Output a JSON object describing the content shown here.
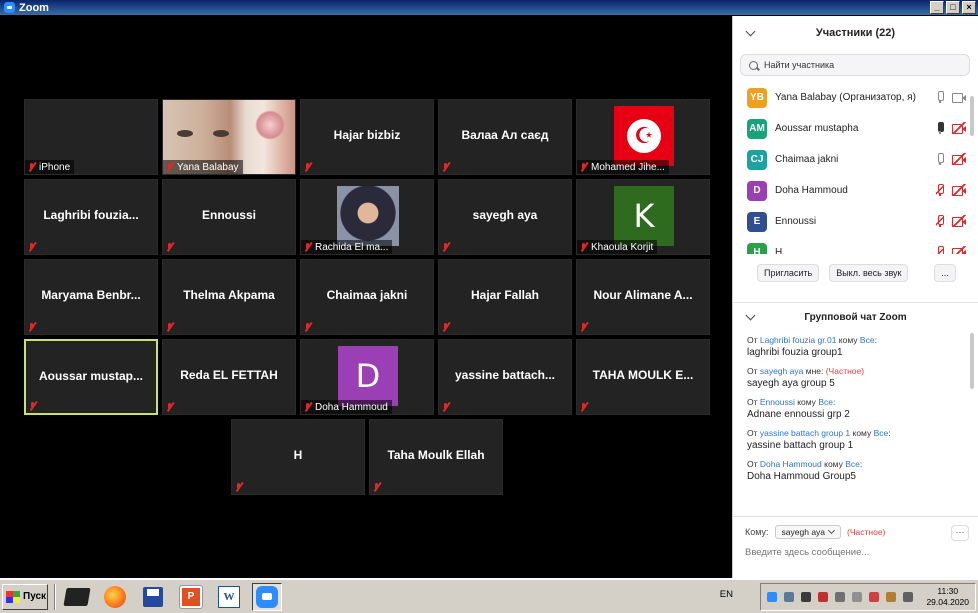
{
  "window": {
    "title": "Zoom"
  },
  "tiles": [
    {
      "name": "iPhone",
      "display": "label"
    },
    {
      "name": "Yana Balabay",
      "display": "photo-face"
    },
    {
      "name": "Hajar bizbiz",
      "display": "center"
    },
    {
      "name": "Валаа Ал саєд",
      "display": "center"
    },
    {
      "name": "Mohamed Jihe...",
      "display": "flag"
    },
    {
      "name": "Laghribi  fouzia...",
      "display": "center"
    },
    {
      "name": "Ennoussi",
      "display": "center"
    },
    {
      "name": "Rachida El ma...",
      "display": "photo-hijab"
    },
    {
      "name": "sayegh aya",
      "display": "center"
    },
    {
      "name": "Khaoula Korjit",
      "display": "avatar",
      "letter": "K",
      "color": "#2e6b1f"
    },
    {
      "name": "Maryama  Benbr...",
      "display": "center"
    },
    {
      "name": "Thelma Akpama",
      "display": "center"
    },
    {
      "name": "Chaimaa jakni",
      "display": "center"
    },
    {
      "name": "Hajar Fallah",
      "display": "center"
    },
    {
      "name": "Nour Alimane A...",
      "display": "center"
    },
    {
      "name": "Aoussar mustap...",
      "display": "center",
      "active": true
    },
    {
      "name": "Reda EL FETTAH",
      "display": "center"
    },
    {
      "name": "Doha Hammoud",
      "display": "avatar",
      "letter": "D",
      "color": "#9b3fb5"
    },
    {
      "name": "yassine  battach...",
      "display": "center"
    },
    {
      "name": "TAHA MOULK E...",
      "display": "center"
    },
    {
      "name": "H",
      "display": "center"
    },
    {
      "name": "Taha Moulk Ellah",
      "display": "center"
    }
  ],
  "participants_panel": {
    "title": "Участники (22)",
    "search_placeholder": "Найти участника",
    "list": [
      {
        "initials": "YB",
        "name": "Yana Balabay (Организатор, я)",
        "color": "#f0a020",
        "mic": "on",
        "cam": "on"
      },
      {
        "initials": "AM",
        "name": "Aoussar mustapha",
        "color": "#1aa37a",
        "mic": "dark",
        "cam": "off"
      },
      {
        "initials": "CJ",
        "name": "Chaimaa jakni",
        "color": "#1aa3a0",
        "mic": "on",
        "cam": "off"
      },
      {
        "initials": "D",
        "name": "Doha Hammoud",
        "color": "#9b3fb5",
        "mic": "off",
        "cam": "off"
      },
      {
        "initials": "E",
        "name": "Ennoussi",
        "color": "#2f4f8f",
        "mic": "off",
        "cam": "off"
      },
      {
        "initials": "H",
        "name": "H",
        "color": "#2aa04a",
        "mic": "off",
        "cam": "off"
      }
    ],
    "invite_label": "Пригласить",
    "mute_all_label": "Выкл. весь звук",
    "more_label": "..."
  },
  "chat": {
    "title": "Групповой чат Zoom",
    "messages": [
      {
        "prefix": "От ",
        "from": "Laghribi fouzia gr.01",
        "mid": " кому ",
        "to": "Все",
        "suffix": ":",
        "private": "",
        "text": "laghribi fouzia group1"
      },
      {
        "prefix": "От ",
        "from": "sayegh aya",
        "mid": " мне: ",
        "to": "",
        "suffix": "",
        "private": "(Частное)",
        "text": "sayegh aya group 5"
      },
      {
        "prefix": "От ",
        "from": "Ennoussi",
        "mid": " кому ",
        "to": "Все",
        "suffix": ":",
        "private": "",
        "text": "Adnane ennoussi grp 2"
      },
      {
        "prefix": "От ",
        "from": "yassine battach group 1",
        "mid": " кому ",
        "to": "Все",
        "suffix": ":",
        "private": "",
        "text": "yassine battach group 1"
      },
      {
        "prefix": "От ",
        "from": "Doha Hammoud",
        "mid": " кому ",
        "to": "Все",
        "suffix": ":",
        "private": "",
        "text": "Doha Hammoud Group5"
      }
    ],
    "to_label": "Кому:",
    "to_value": "sayegh aya",
    "private_label": "(Частное)",
    "more_label": "···",
    "input_placeholder": "Введите здесь сообщение..."
  },
  "taskbar": {
    "start_label": "Пуск",
    "language": "EN",
    "time": "11:30",
    "date": "29.04.2020"
  }
}
